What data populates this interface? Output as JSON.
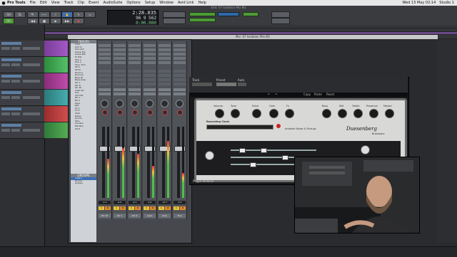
{
  "menubar": {
    "app": "Pro Tools",
    "items": [
      "File",
      "Edit",
      "View",
      "Track",
      "Clip",
      "Event",
      "AudioSuite",
      "Options",
      "Setup",
      "Window",
      "Avid Link",
      "Help"
    ],
    "right": [
      "Wed 13 May 02:14",
      "Studio 1"
    ]
  },
  "edit_window": {
    "title": "Edit: 07 Isolation Mix BG",
    "counter": {
      "main": "2:28.835",
      "sub": "96 9 562",
      "third": "0:00.000"
    }
  },
  "mix_window": {
    "title": "Mix: 07 Isolation Mix BG",
    "tracks_header": "TRACKS",
    "track_list": [
      "Click",
      "Kick In",
      "Kick Out",
      "Snare Top",
      "Snare Bot",
      "Hi Hat",
      "Tom 1",
      "Tom 2",
      "Floor Tom",
      "OH L",
      "OH R",
      "Room L",
      "Room R",
      "Bass DI",
      "Bass Amp",
      "Gtr L",
      "Gtr R",
      "Gtr DI",
      "Lead Gtr",
      "Vox",
      "Vox Dbl",
      "BV 1",
      "BV 2",
      "Keys",
      "Pad",
      "FX 1",
      "FX 2",
      "Verb",
      "Delay",
      "Drums",
      "Gtrs",
      "Vox Bus",
      "Mix Bus",
      "Print"
    ],
    "groups_header": "GROUPS",
    "groups": [
      "<ALL>",
      "Drums",
      "Guitars"
    ],
    "strips": [
      {
        "name": "Gtr DI",
        "vol": "-1.3",
        "meter": 0.55
      },
      {
        "name": "Gtr L",
        "vol": "0.0",
        "meter": 0.7
      },
      {
        "name": "Gtr R",
        "vol": "-2.1",
        "meter": 0.62
      },
      {
        "name": "Lead",
        "vol": "-4.5",
        "meter": 0.45
      },
      {
        "name": "Amp",
        "vol": "+0.7",
        "meter": 0.8
      },
      {
        "name": "Bus",
        "vol": "-3.0",
        "meter": 0.35
      }
    ],
    "strip_sm": {
      "s": "S",
      "m": "M"
    }
  },
  "plugin": {
    "preset_label": "Preset",
    "track_label": "Track",
    "auto_label": "Auto",
    "tabs": [
      "Copy",
      "Paste",
      "Reset",
      "??"
    ],
    "brand": "Duesenberg",
    "secondary_brand": "Brainworx",
    "record_label": "Recording Chain",
    "noise_label": "Ambient Noise & Pickups",
    "section_labels": [
      "Volume",
      "Tone",
      "Drive",
      "Gain",
      "Fx",
      "Bass",
      "Mid",
      "Treble",
      "Presence",
      "Master"
    ],
    "footer": "Plugin Alliance"
  }
}
